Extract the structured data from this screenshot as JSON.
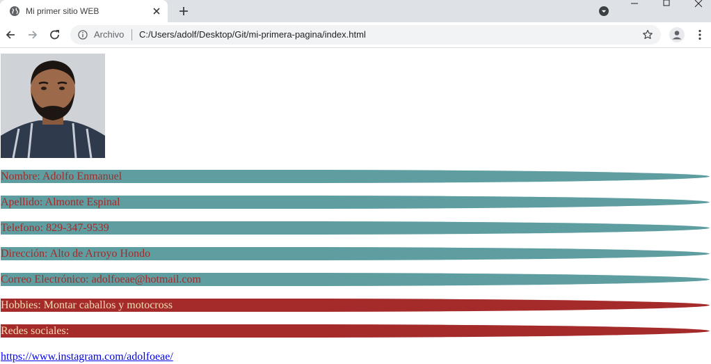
{
  "browser": {
    "tab_title": "Mi primer sitio WEB",
    "scheme_label": "Archivo",
    "url": "C:/Users/adolf/Desktop/Git/mi-primera-pagina/index.html"
  },
  "profile": {
    "rows": [
      {
        "label": "Nombre: Adolfo Enmanuel"
      },
      {
        "label": "Apellido: Almonte Espinal"
      },
      {
        "label": "Telefono: 829-347-9539"
      },
      {
        "label": "Dirección: Alto de Arroyo Hondo"
      },
      {
        "label": "Correo Electrónico: adolfoeae@hotmail.com"
      },
      {
        "label": "Hobbies: Montar caballos y motocross"
      },
      {
        "label": "Redes sociales:"
      }
    ],
    "instagram_link": "https://www.instagram.com/adolfoeae/"
  },
  "colors": {
    "teal_bar": "#5f9ea0",
    "red_bar": "#a52a2a",
    "teal_text": "#a52a2a",
    "red_text": "#f5deb3",
    "link": "#0000ee"
  }
}
